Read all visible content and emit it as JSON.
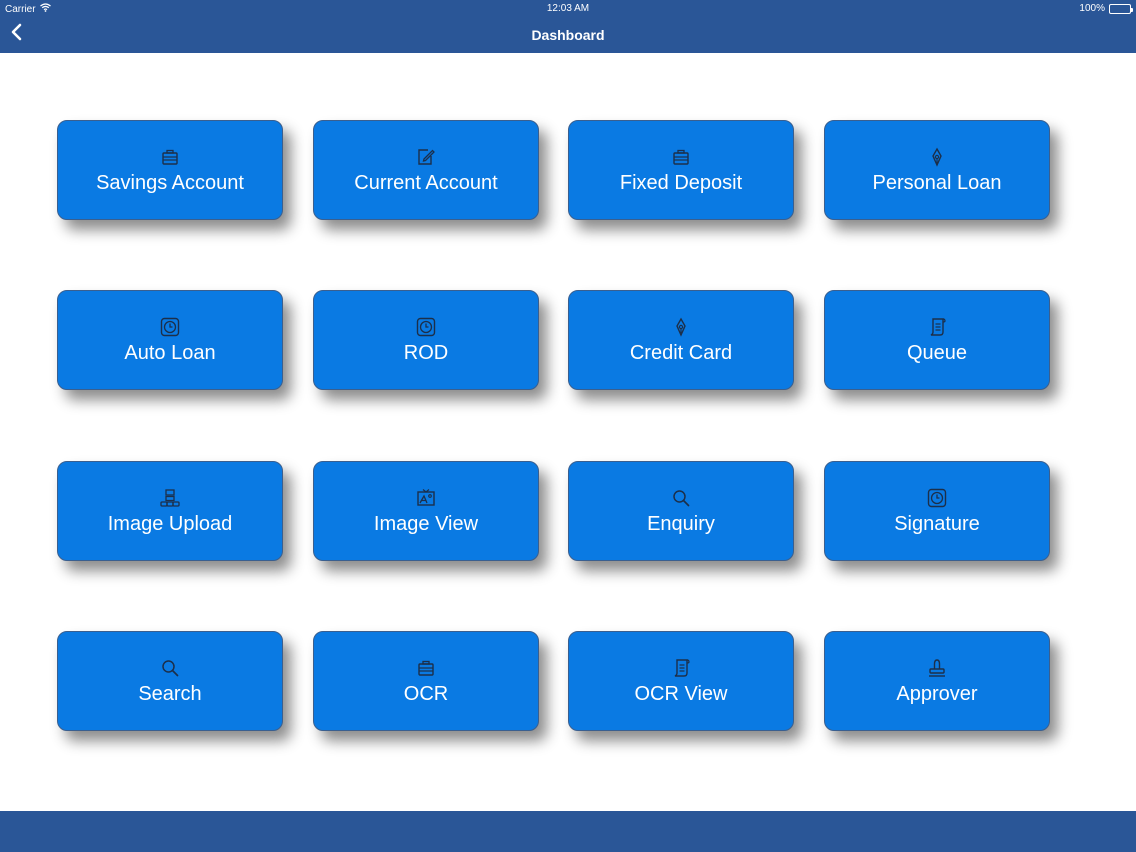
{
  "status_bar": {
    "carrier": "Carrier",
    "time": "12:03 AM",
    "battery": "100%"
  },
  "nav": {
    "title": "Dashboard",
    "back_icon": "chevron-left-icon"
  },
  "colors": {
    "bar": "#2a5697",
    "tile": "#0a7ae3",
    "icon": "#1c2f4a"
  },
  "tiles": [
    {
      "label": "Savings Account",
      "icon": "briefcase-icon"
    },
    {
      "label": "Current Account",
      "icon": "edit-icon"
    },
    {
      "label": "Fixed Deposit",
      "icon": "briefcase-icon"
    },
    {
      "label": "Personal Loan",
      "icon": "pen-nib-icon"
    },
    {
      "label": "Auto Loan",
      "icon": "clock-icon"
    },
    {
      "label": "ROD",
      "icon": "clock-icon"
    },
    {
      "label": "Credit Card",
      "icon": "pen-nib-icon"
    },
    {
      "label": "Queue",
      "icon": "scroll-icon"
    },
    {
      "label": "Image Upload",
      "icon": "network-icon"
    },
    {
      "label": "Image View",
      "icon": "picture-icon"
    },
    {
      "label": "Enquiry",
      "icon": "search-icon"
    },
    {
      "label": "Signature",
      "icon": "clock-icon"
    },
    {
      "label": "Search",
      "icon": "search-icon"
    },
    {
      "label": "OCR",
      "icon": "briefcase-icon"
    },
    {
      "label": "OCR View",
      "icon": "scroll-icon"
    },
    {
      "label": "Approver",
      "icon": "stamp-icon"
    }
  ]
}
